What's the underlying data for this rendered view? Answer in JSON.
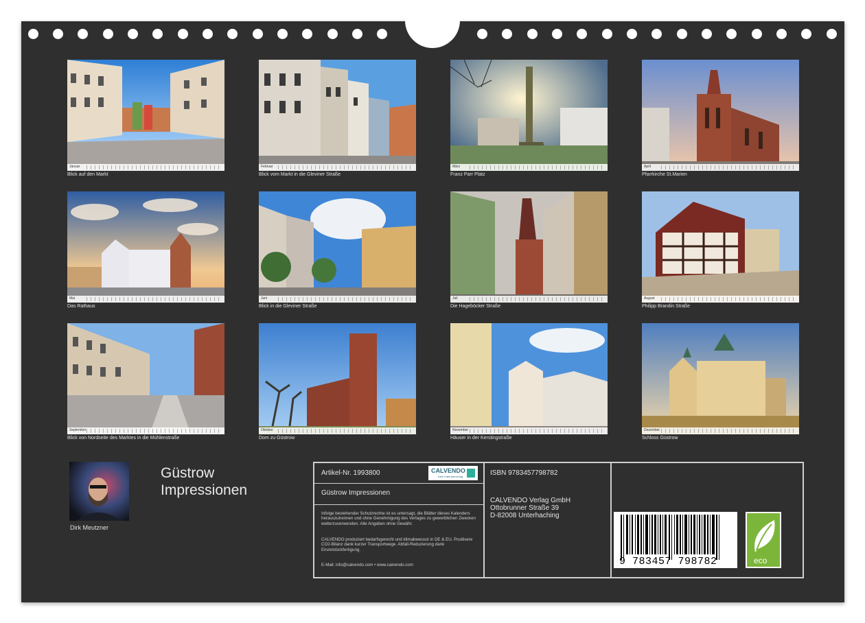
{
  "calendar": {
    "title_line1": "Güstrow",
    "title_line2": "Impressionen",
    "author": "Dirk Meutzner"
  },
  "months": [
    {
      "month": "Januar",
      "caption": "Blick auf den Markt"
    },
    {
      "month": "Februar",
      "caption": "Blick vom Markt in die Gleviner Straße"
    },
    {
      "month": "März",
      "caption": "Franz Parr Platz"
    },
    {
      "month": "April",
      "caption": "Pfarrkirche St.Marien"
    },
    {
      "month": "Mai",
      "caption": "Das Rathaus"
    },
    {
      "month": "Juni",
      "caption": "Blick in die Gleviner Straße"
    },
    {
      "month": "Juli",
      "caption": "Die Hageböcker Straße"
    },
    {
      "month": "August",
      "caption": "Philipp Brandin Straße"
    },
    {
      "month": "September",
      "caption": "Blick von Nordseite des Marktes in die Mühlenstraße"
    },
    {
      "month": "Oktober",
      "caption": "Dom zu Güstrow"
    },
    {
      "month": "November",
      "caption": "Häuser in der Kerstingstraße"
    },
    {
      "month": "Dezember",
      "caption": "Schloss Güstrow"
    }
  ],
  "info": {
    "article": "Artikel-Nr. 1993800",
    "product_title": "Güstrow Impressionen",
    "logo_text": "CALVENDO",
    "logo_sub": "Dein Kalenderverlag",
    "legal1": "Infolge bestehender Schutzrechte ist es untersagt, die Blätter dieses Kalenders herauszutrennen und ohne Genehmigung des Verlages zu gewerblichen Zwecken weiterzuverwenden. Alle Angaben ohne Gewähr.",
    "legal2": "CALVENDO produziert bedarfsgerecht und klimabewusst in DE & EU. Positivere CO2-Bilanz dank kurzer Transportwege. Abfall-Reduzierung dank Einzelstückfertigung.",
    "contact": "E-Mail: info@calvendo.com • www.calvendo.com",
    "isbn": "ISBN 9783457798782",
    "publisher_name": "CALVENDO Verlag GmbH",
    "publisher_street": "Ottobrunner Straße 39",
    "publisher_city": "D-82008 Unterhaching",
    "barcode_digits": "9 783457 798782",
    "eco_label": "eco"
  }
}
